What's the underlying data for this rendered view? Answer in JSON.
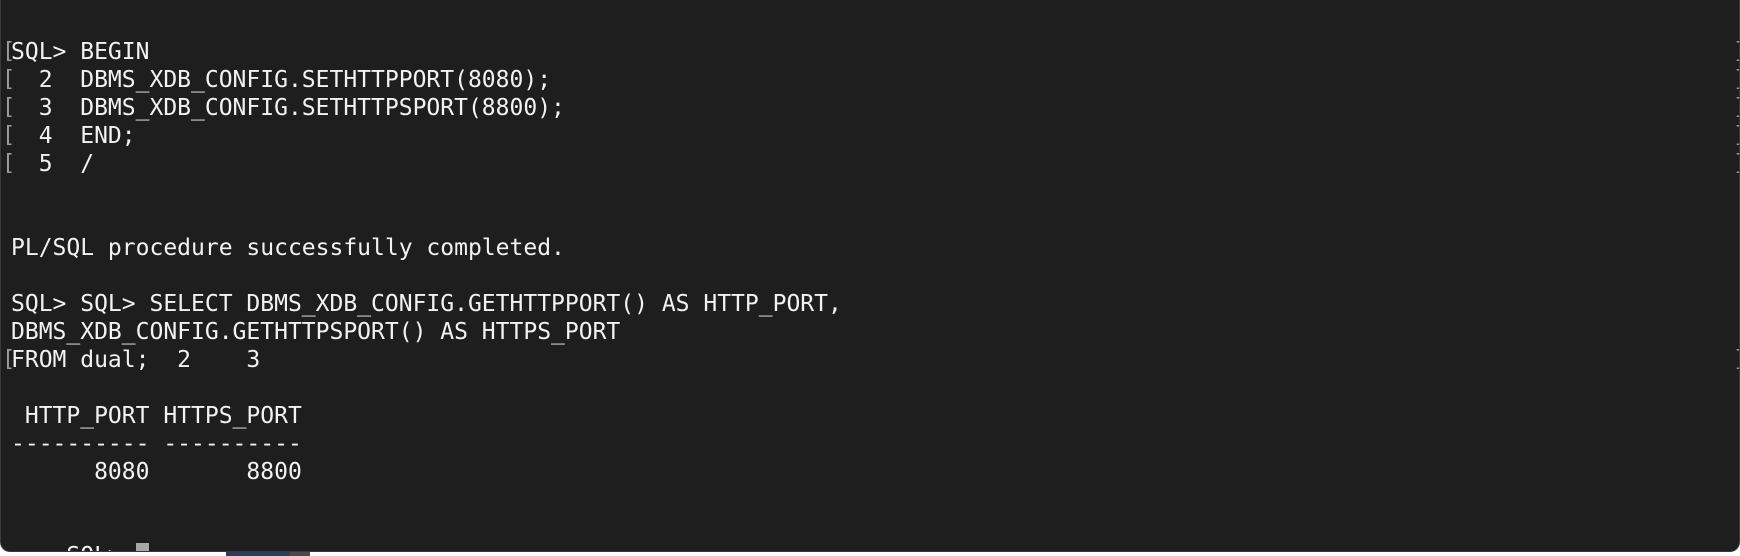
{
  "terminal": {
    "lines": [
      {
        "text": "SQL> BEGIN",
        "bracketed": true
      },
      {
        "text": "  2  DBMS_XDB_CONFIG.SETHTTPPORT(8080);",
        "bracketed": true
      },
      {
        "text": "  3  DBMS_XDB_CONFIG.SETHTTPSPORT(8800);",
        "bracketed": true
      },
      {
        "text": "  4  END;",
        "bracketed": true
      },
      {
        "text": "  5  /",
        "bracketed": true
      },
      {
        "text": "",
        "bracketed": false
      },
      {
        "text": "",
        "bracketed": false
      },
      {
        "text": "PL/SQL procedure successfully completed.",
        "bracketed": false
      },
      {
        "text": "",
        "bracketed": false
      },
      {
        "text": "SQL> SQL> SELECT DBMS_XDB_CONFIG.GETHTTPPORT() AS HTTP_PORT,",
        "bracketed": false
      },
      {
        "text": "DBMS_XDB_CONFIG.GETHTTPSPORT() AS HTTPS_PORT",
        "bracketed": false
      },
      {
        "text": "FROM dual;  2    3",
        "bracketed": true
      },
      {
        "text": "",
        "bracketed": false
      },
      {
        "text": " HTTP_PORT HTTPS_PORT",
        "bracketed": false
      },
      {
        "text": "---------- ----------",
        "bracketed": false
      },
      {
        "text": "      8080       8800",
        "bracketed": false
      },
      {
        "text": "",
        "bracketed": false
      }
    ],
    "prompt": "SQL> ",
    "bracket_left": "[",
    "bracket_right": "]"
  },
  "colors": {
    "background": "#1e1e1e",
    "foreground": "#f2f2f2",
    "cursor": "#a8a8a8"
  }
}
